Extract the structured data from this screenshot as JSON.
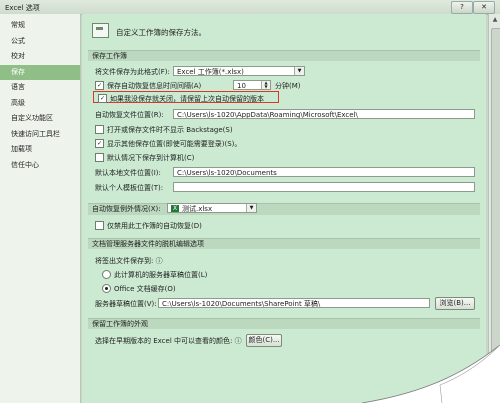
{
  "window": {
    "title": "Excel 选项",
    "help_glyph": "?",
    "close_glyph": "✕"
  },
  "sidebar": {
    "items": [
      {
        "label": "常规"
      },
      {
        "label": "公式"
      },
      {
        "label": "校对"
      },
      {
        "label": "保存",
        "selected": true
      },
      {
        "label": "语言"
      },
      {
        "label": "高级"
      },
      {
        "label": "自定义功能区"
      },
      {
        "label": "快速访问工具栏"
      },
      {
        "label": "加载项"
      },
      {
        "label": "信任中心"
      }
    ]
  },
  "header": {
    "title": "自定义工作簿的保存方法。"
  },
  "save_workbooks": {
    "section_title": "保存工作簿",
    "format_label": "将文件保存为此格式(F):",
    "format_value": "Excel 工作簿(*.xlsx)",
    "autorecover_label": "保存自动恢复信息时间间隔(A)",
    "autorecover_checked": true,
    "autorecover_minutes": "10",
    "minutes_label": "分钟(M)",
    "keep_last_label": "如果我没保存就关闭，请保留上次自动保留的版本",
    "keep_last_checked": true,
    "autorecover_location_label": "自动恢复文件位置(R):",
    "autorecover_location_value": "C:\\Users\\ls-1020\\AppData\\Roaming\\Microsoft\\Excel\\",
    "no_backstage_label": "打开或保存文件时不显示 Backstage(S)",
    "no_backstage_checked": false,
    "show_other_label": "显示其他保存位置(即使可能需要登录)(S)。",
    "show_other_checked": true,
    "default_computer_label": "默认情况下保存到计算机(C)",
    "default_computer_checked": false,
    "default_local_label": "默认本地文件位置(I):",
    "default_local_value": "C:\\Users\\ls-1020\\Documents",
    "personal_templates_label": "默认个人模板位置(T):",
    "personal_templates_value": ""
  },
  "autorecover_exceptions": {
    "label": "自动恢复例外情况(X):",
    "file_value": "测试.xlsx",
    "disable_label": "仅禁用此工作簿的自动恢复(D)",
    "disable_checked": false
  },
  "offline_editing": {
    "section_title": "文档管理服务器文件的脱机编辑选项",
    "save_to_label": "将签出文件保存到:",
    "server_drafts_label": "此计算机的服务器草稿位置(L)",
    "office_cache_label": "Office 文档缓存(O)",
    "office_cache_selected": true,
    "server_drafts_location_label": "服务器草稿位置(V):",
    "server_drafts_location_value": "C:\\Users\\ls-1020\\Documents\\SharePoint 草稿\\",
    "browse_label": "浏览(B)..."
  },
  "appearance": {
    "section_title": "保留工作簿的外观",
    "colors_label": "选择在早期版本的 Excel 中可以查看的颜色:",
    "colors_button": "颜色(C)..."
  },
  "icons": {
    "excel_file": "excel-file-icon",
    "dropdown": "chevron-down-icon",
    "info": "info-icon"
  }
}
